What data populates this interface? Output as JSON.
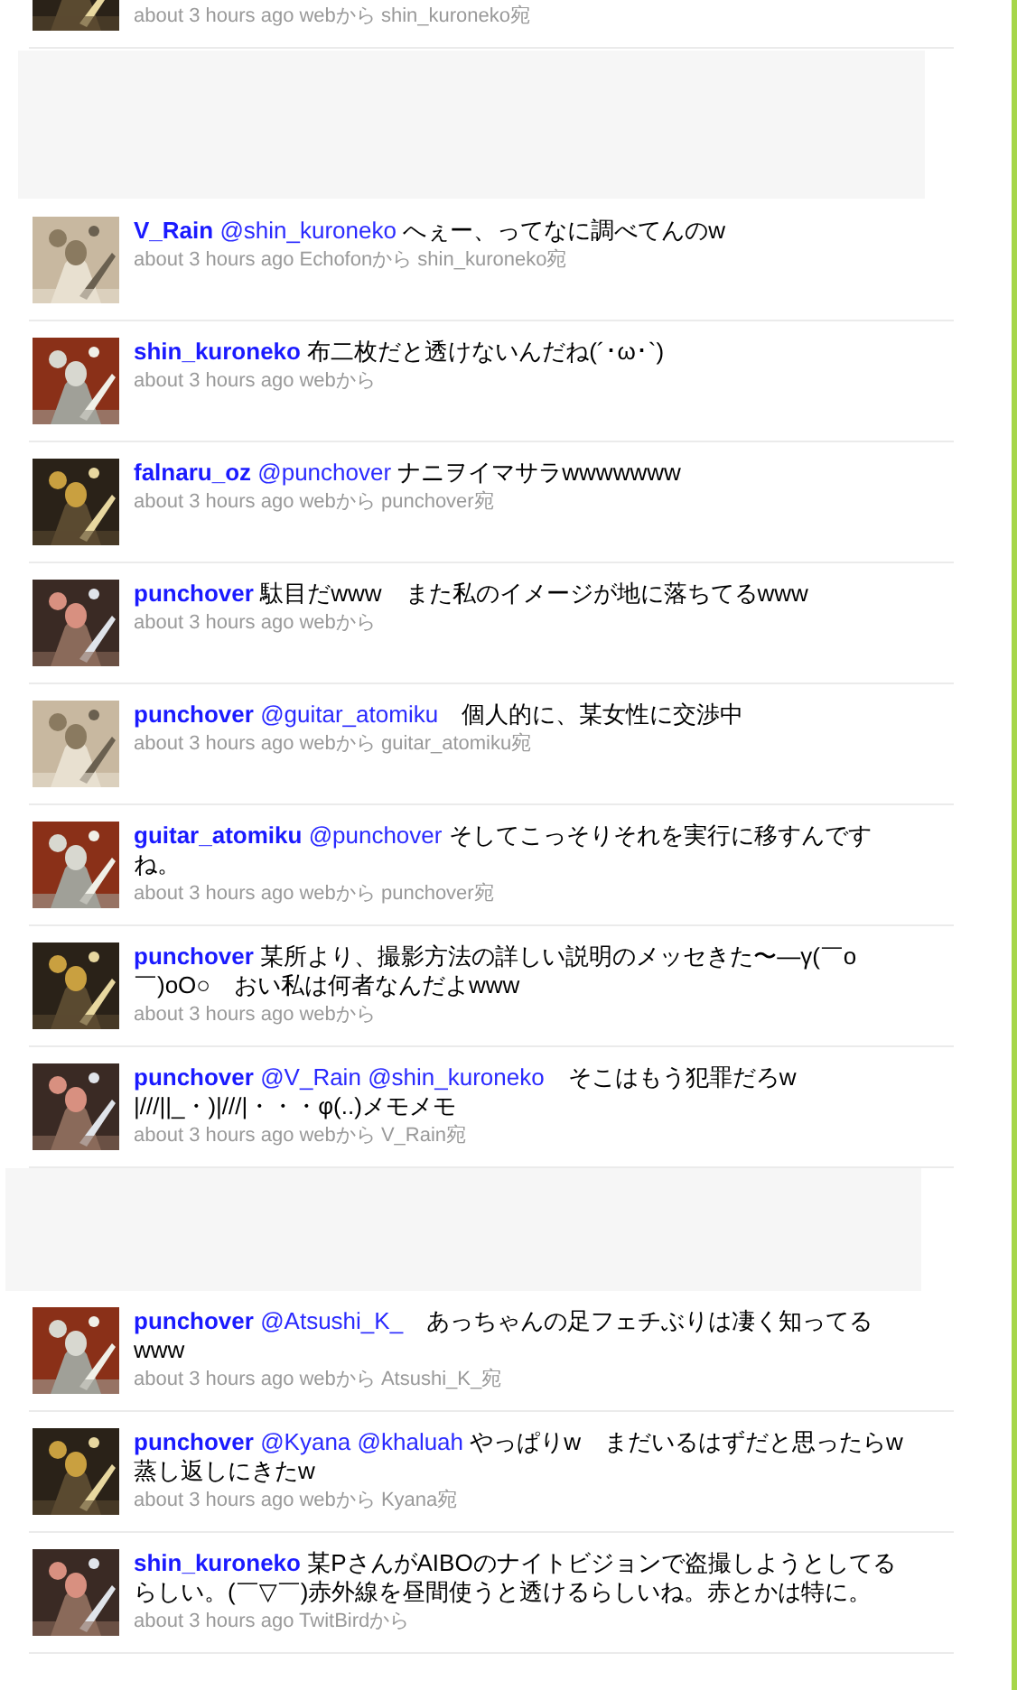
{
  "timeline": [
    {
      "kind": "partial_tweet",
      "avatar": {
        "kind": "picture"
      },
      "meta": "about 3 hours ago webから shin_kuroneko宛"
    },
    {
      "kind": "blank"
    },
    {
      "kind": "tweet",
      "avatar": {
        "kind": "picture"
      },
      "user": "V_Rain",
      "text": [
        {
          "kind": "mention",
          "text": "@shin_kuroneko"
        },
        {
          "kind": "plain",
          "text": " へぇー、ってなに調べてんのw"
        }
      ],
      "meta": "about 3 hours ago Echofonから shin_kuroneko宛"
    },
    {
      "kind": "tweet",
      "avatar": {
        "kind": "picture"
      },
      "user": "shin_kuroneko",
      "text": [
        {
          "kind": "plain",
          "text": "布二枚だと透けないんだね(´･ω･`)"
        }
      ],
      "meta": "about 3 hours ago webから"
    },
    {
      "kind": "tweet",
      "avatar": {
        "kind": "picture"
      },
      "user": "falnaru_oz",
      "text": [
        {
          "kind": "mention",
          "text": "@punchover"
        },
        {
          "kind": "plain",
          "text": " ナニヲイマサラwwwwwww"
        }
      ],
      "meta": "about 3 hours ago webから punchover宛"
    },
    {
      "kind": "tweet",
      "avatar": {
        "kind": "picture"
      },
      "user": "punchover",
      "text": [
        {
          "kind": "plain",
          "text": "駄目だwww　また私のイメージが地に落ちてるwww"
        }
      ],
      "meta": "about 3 hours ago webから"
    },
    {
      "kind": "tweet",
      "avatar": {
        "kind": "picture"
      },
      "user": "punchover",
      "text": [
        {
          "kind": "mention",
          "text": "@guitar_atomiku"
        },
        {
          "kind": "plain",
          "text": "　個人的に、某女性に交渉中"
        }
      ],
      "meta": "about 3 hours ago webから guitar_atomiku宛"
    },
    {
      "kind": "tweet",
      "avatar": {
        "kind": "picture"
      },
      "user": "guitar_atomiku",
      "text": [
        {
          "kind": "mention",
          "text": "@punchover"
        },
        {
          "kind": "plain",
          "text": " そしてこっそりそれを実行に移すんですね。"
        }
      ],
      "meta": "about 3 hours ago webから punchover宛"
    },
    {
      "kind": "tweet",
      "avatar": {
        "kind": "picture"
      },
      "user": "punchover",
      "text": [
        {
          "kind": "plain",
          "text": "某所より、撮影方法の詳しい説明のメッセきた〜―γ(￣o￣)oO○　おい私は何者なんだよwww"
        }
      ],
      "meta": "about 3 hours ago webから"
    },
    {
      "kind": "tweet",
      "avatar": {
        "kind": "picture"
      },
      "user": "punchover",
      "text": [
        {
          "kind": "mention",
          "text": "@V_Rain"
        },
        {
          "kind": "mention",
          "text": "@shin_kuroneko"
        },
        {
          "kind": "plain",
          "text": "　そこはもう犯罪だろw |///||_・)|///|・・・φ(..)メモメモ"
        }
      ],
      "meta": "about 3 hours ago webから V_Rain宛"
    },
    {
      "kind": "blank"
    },
    {
      "kind": "tweet",
      "avatar": {
        "kind": "picture"
      },
      "user": "punchover",
      "text": [
        {
          "kind": "mention",
          "text": "@Atsushi_K_"
        },
        {
          "kind": "plain",
          "text": "　あっちゃんの足フェチぶりは凄く知ってるwww"
        }
      ],
      "meta": "about 3 hours ago webから Atsushi_K_宛"
    },
    {
      "kind": "tweet",
      "avatar": {
        "kind": "picture"
      },
      "user": "punchover",
      "text": [
        {
          "kind": "mention",
          "text": "@Kyana"
        },
        {
          "kind": "mention",
          "text": "@khaluah"
        },
        {
          "kind": "plain",
          "text": " やっぱりw　まだいるはずだと思ったらw　蒸し返しにきたw"
        }
      ],
      "meta": "about 3 hours ago webから Kyana宛"
    },
    {
      "kind": "tweet",
      "avatar": {
        "kind": "picture"
      },
      "user": "shin_kuroneko",
      "text": [
        {
          "kind": "plain",
          "text": "某PさんがAIBOのナイトビジョンで盗撮しようとしてるらしい。(￣▽￣)赤外線を昼間使うと透けるらしいね。赤とかは特に。"
        }
      ],
      "meta": "about 3 hours ago TwitBirdから"
    }
  ]
}
